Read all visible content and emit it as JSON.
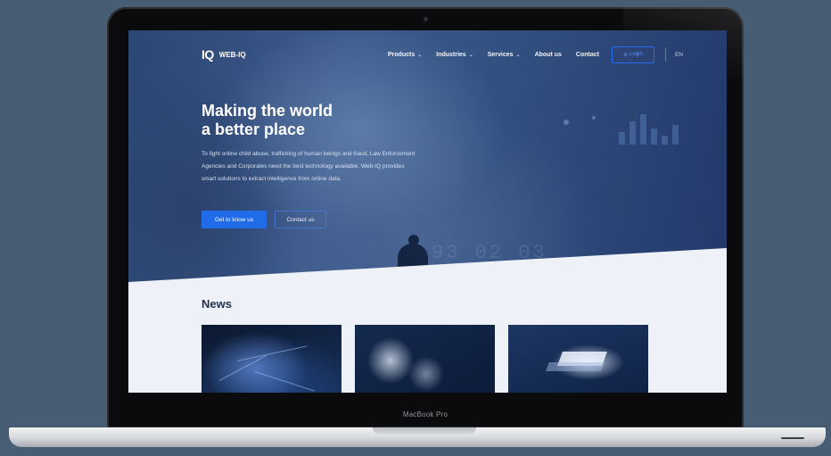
{
  "device": {
    "model_label": "MacBook Pro"
  },
  "nav": {
    "logo_mark": "IQ",
    "logo_text": "WEB-IQ",
    "menu": [
      {
        "label": "Products",
        "has_dropdown": true
      },
      {
        "label": "Industries",
        "has_dropdown": true
      },
      {
        "label": "Services",
        "has_dropdown": true
      },
      {
        "label": "About us",
        "has_dropdown": false
      },
      {
        "label": "Contact",
        "has_dropdown": false
      }
    ],
    "login_label": "Login",
    "language": "EN"
  },
  "hero": {
    "title_line1": "Making the world",
    "title_line2": "a better place",
    "body": "To fight online child abuse, trafficking of human beings and fraud, Law Enforcement Agencies and Corporates need the best technology available. Web-IQ provides smart solutions to extract intelligence from online data.",
    "primary_cta": "Get to know us",
    "secondary_cta": "Contact us",
    "decor_digits": "93 02 03"
  },
  "news": {
    "title": "News"
  },
  "colors": {
    "background": "#475d73",
    "accent": "#1f6be8",
    "hero_dark": "#2c4673"
  }
}
